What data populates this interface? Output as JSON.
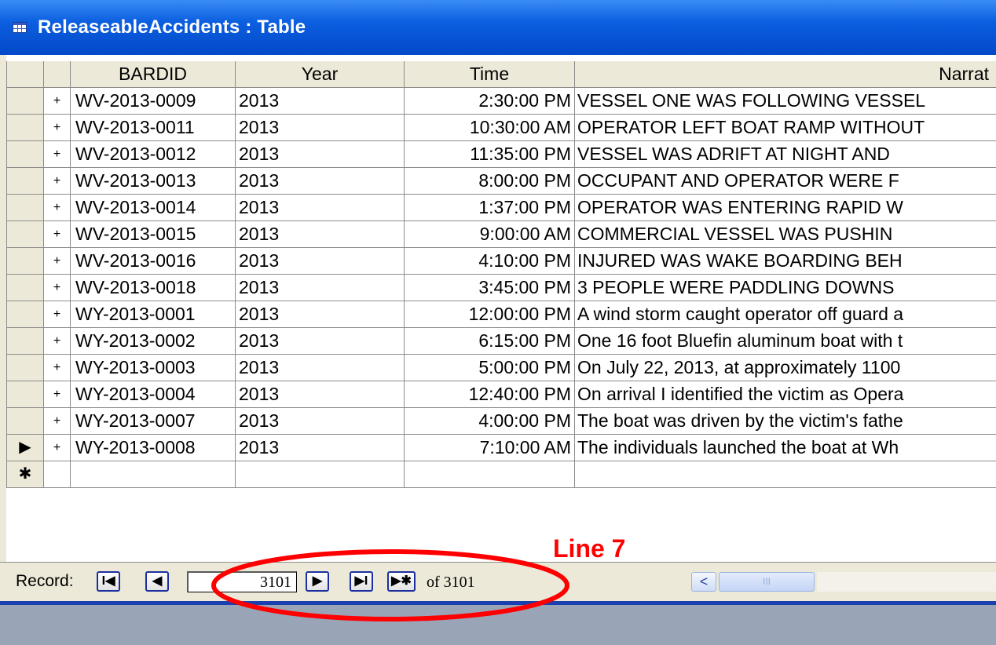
{
  "window": {
    "title": "ReleaseableAccidents : Table"
  },
  "columns": {
    "bardid": "BARDID",
    "year": "Year",
    "time": "Time",
    "narrative": "Narrat"
  },
  "rows": [
    {
      "bardid": "WV-2013-0009",
      "year": "2013",
      "time": "2:30:00 PM",
      "narrative": "VESSEL ONE WAS FOLLOWING VESSEL",
      "expander": "+"
    },
    {
      "bardid": "WV-2013-0011",
      "year": "2013",
      "time": "10:30:00 AM",
      "narrative": "OPERATOR LEFT BOAT RAMP WITHOUT",
      "expander": "+"
    },
    {
      "bardid": "WV-2013-0012",
      "year": "2013",
      "time": "11:35:00 PM",
      "narrative": "VESSEL WAS ADRIFT AT NIGHT AND",
      "expander": "+"
    },
    {
      "bardid": "WV-2013-0013",
      "year": "2013",
      "time": "8:00:00 PM",
      "narrative": "OCCUPANT AND OPERATOR WERE F",
      "expander": "+"
    },
    {
      "bardid": "WV-2013-0014",
      "year": "2013",
      "time": "1:37:00 PM",
      "narrative": "OPERATOR WAS ENTERING RAPID W",
      "expander": "+"
    },
    {
      "bardid": "WV-2013-0015",
      "year": "2013",
      "time": "9:00:00 AM",
      "narrative": "COMMERCIAL VESSEL WAS PUSHIN",
      "expander": "+"
    },
    {
      "bardid": "WV-2013-0016",
      "year": "2013",
      "time": "4:10:00 PM",
      "narrative": "INJURED WAS WAKE BOARDING BEH",
      "expander": "+"
    },
    {
      "bardid": "WV-2013-0018",
      "year": "2013",
      "time": "3:45:00 PM",
      "narrative": "3 PEOPLE WERE PADDLING DOWNS",
      "expander": "+"
    },
    {
      "bardid": "WY-2013-0001",
      "year": "2013",
      "time": "12:00:00 PM",
      "narrative": "A wind storm caught operator off guard a",
      "expander": "+"
    },
    {
      "bardid": "WY-2013-0002",
      "year": "2013",
      "time": "6:15:00 PM",
      "narrative": "One 16 foot Bluefin aluminum boat with t",
      "expander": "+"
    },
    {
      "bardid": "WY-2013-0003",
      "year": "2013",
      "time": "5:00:00 PM",
      "narrative": "On July 22, 2013, at approximately 1100",
      "expander": "+"
    },
    {
      "bardid": "WY-2013-0004",
      "year": "2013",
      "time": "12:40:00 PM",
      "narrative": "On arrival I identified the victim as Opera",
      "expander": "+"
    },
    {
      "bardid": "WY-2013-0007",
      "year": "2013",
      "time": "4:00:00 PM",
      "narrative": "The boat was driven by the victim's fathe",
      "expander": "+"
    },
    {
      "bardid": "WY-2013-0008",
      "year": "2013",
      "time": "7:10:00 AM",
      "narrative": "The individuals launched the boat at Wh",
      "expander": "+"
    }
  ],
  "current_row_marker": "▶",
  "new_row_marker": "✱",
  "navigation": {
    "label": "Record:",
    "first_glyph": "I◀",
    "prev_glyph": "◀",
    "current": "3101",
    "next_glyph": "▶",
    "last_glyph": "▶I",
    "new_glyph": "▶✱",
    "of_text": "of  3101"
  },
  "scrollbar": {
    "left_glyph": "<",
    "thumb_grip": "III"
  },
  "annotation": {
    "label": "Line 7",
    "color": "#ff0000"
  },
  "colors": {
    "titlebar": "#0b5fe0",
    "grid_chrome": "#ece9d8",
    "accent_line": "#1a3fae",
    "background_bottom": "#9aa4b7"
  }
}
